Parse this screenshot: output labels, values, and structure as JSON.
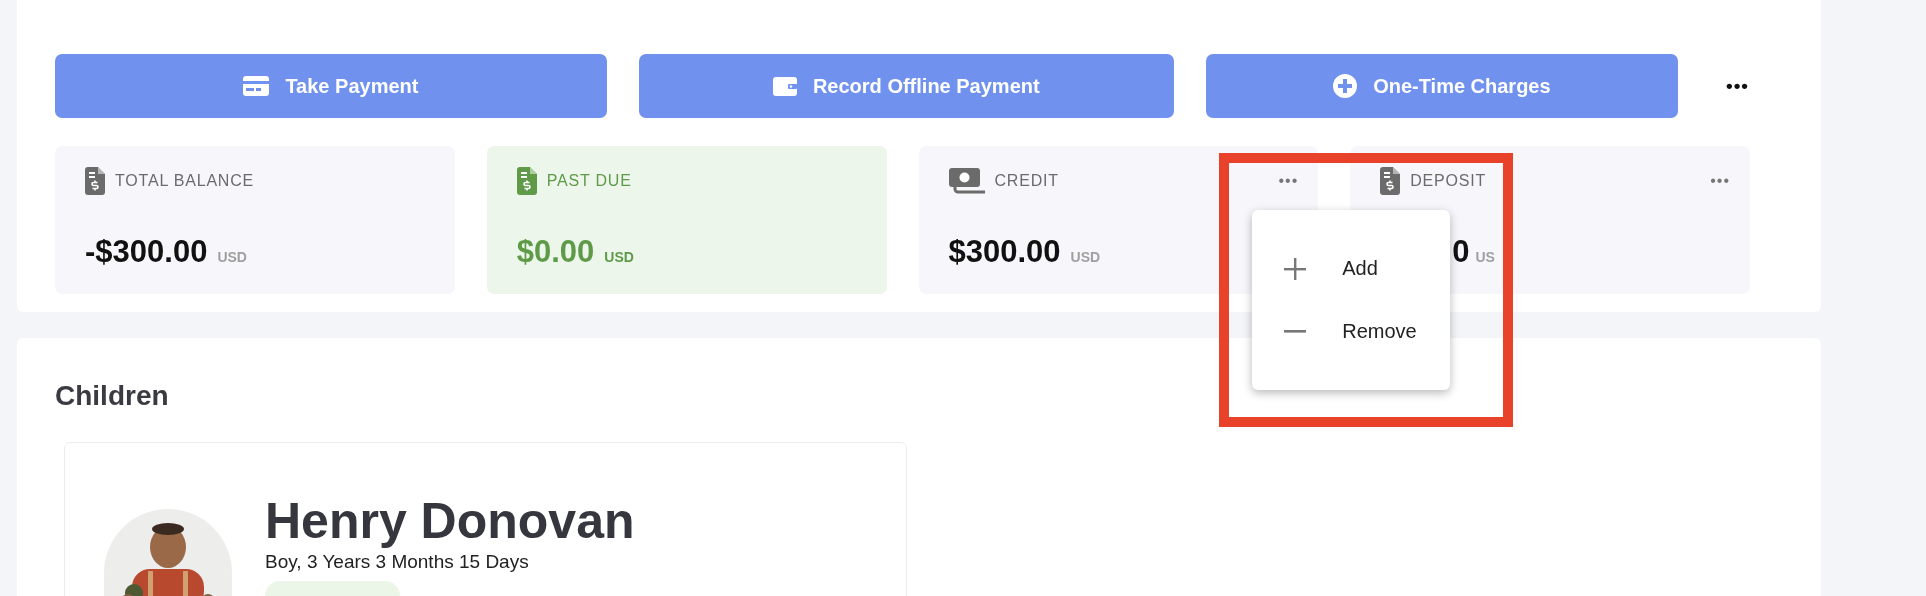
{
  "actions": [
    {
      "kind": "payment",
      "label": "Take Payment"
    },
    {
      "kind": "offline",
      "label": "Record Offline Payment"
    },
    {
      "kind": "charge",
      "label": "One-Time Charges"
    }
  ],
  "more_actions": "•••",
  "balances": [
    {
      "kind": "balance",
      "label": "TOTAL BALANCE",
      "amount": "-$300.00",
      "currency": "USD",
      "highlighted": false,
      "more_button": false,
      "menu_open": false
    },
    {
      "kind": "balance",
      "label": "PAST DUE",
      "amount": "$0.00",
      "currency": "USD",
      "highlighted": true,
      "more_button": false,
      "menu_open": false
    },
    {
      "kind": "credit",
      "label": "CREDIT",
      "amount": "$300.00",
      "currency": "USD",
      "highlighted": false,
      "more_button": true,
      "menu_open": true
    },
    {
      "kind": "balance",
      "label": "DEPOSIT",
      "amount": "0",
      "currency": "US",
      "highlighted": false,
      "more_button": true,
      "menu_open": false
    }
  ],
  "menu": {
    "items": [
      {
        "kind": "add",
        "label": "Add"
      },
      {
        "kind": "remove",
        "label": "Remove"
      }
    ]
  },
  "children_section": {
    "title": "Children",
    "children": [
      {
        "name": "Henry Donovan",
        "details": "Boy, 3 Years 3 Months 15 Days"
      }
    ]
  }
}
